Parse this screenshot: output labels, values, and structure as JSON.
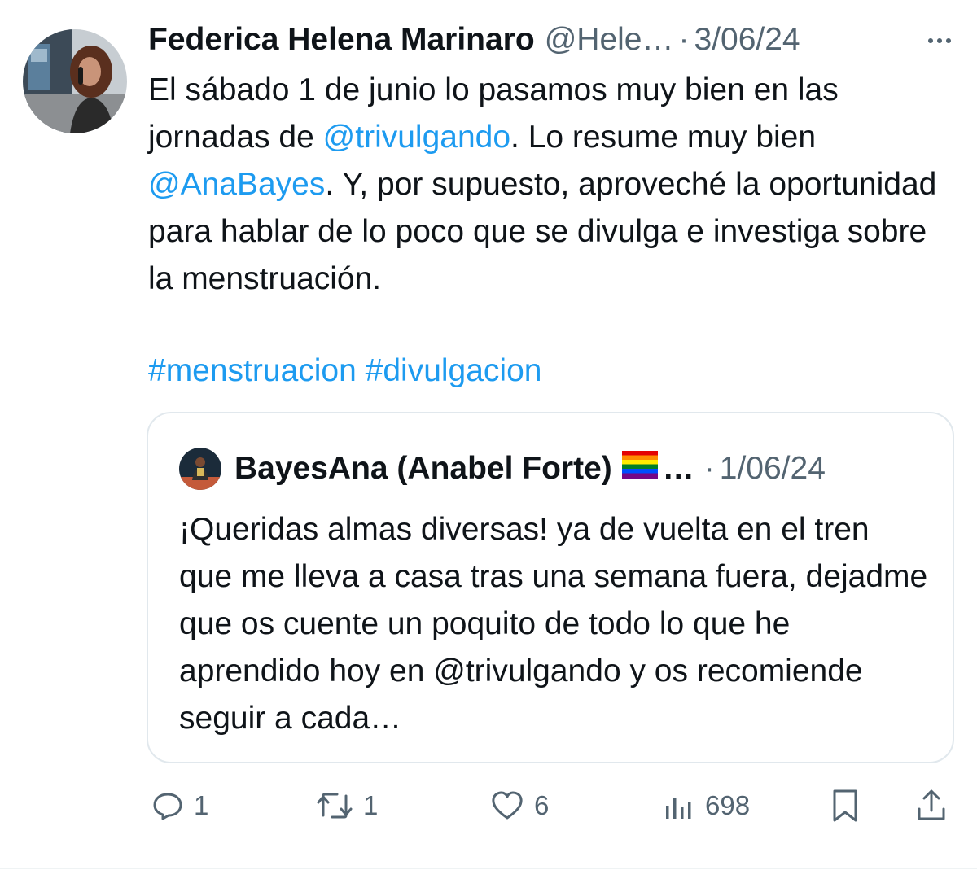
{
  "tweet": {
    "author_name": "Federica Helena Marinaro",
    "author_handle": "@Hele…",
    "separator": "·",
    "date": "3/06/24",
    "more_icon": "more-icon",
    "text_segments": [
      {
        "text": "El sábado 1 de junio lo pasamos muy bien en las jornadas de ",
        "link": false
      },
      {
        "text": "@trivulgando",
        "link": true
      },
      {
        "text": ". Lo resume muy bien ",
        "link": false
      },
      {
        "text": "@AnaBayes",
        "link": true
      },
      {
        "text": ". Y, por supuesto, aproveché la oportunidad para hablar de lo poco que se divulga e investiga sobre la menstruación.",
        "link": false
      }
    ],
    "hashtags": [
      "#menstruacion",
      "#divulgacion"
    ]
  },
  "quote": {
    "author_name": "BayesAna (Anabel Forte)",
    "flag": "🏳️‍🌈",
    "ellipsis": "…",
    "separator": "·",
    "date": "1/06/24",
    "text": "¡Queridas almas diversas! ya de vuelta en el tren que me lleva a casa tras una semana fuera, dejadme que os cuente un poquito de todo lo que he aprendido hoy en @trivulgando y os recomiende seguir a cada…"
  },
  "actions": {
    "replies": "1",
    "retweets": "1",
    "likes": "6",
    "views": "698"
  },
  "colors": {
    "link": "#1d9bf0",
    "muted": "#536471",
    "text": "#0f1419",
    "border": "#e1e8ed"
  }
}
